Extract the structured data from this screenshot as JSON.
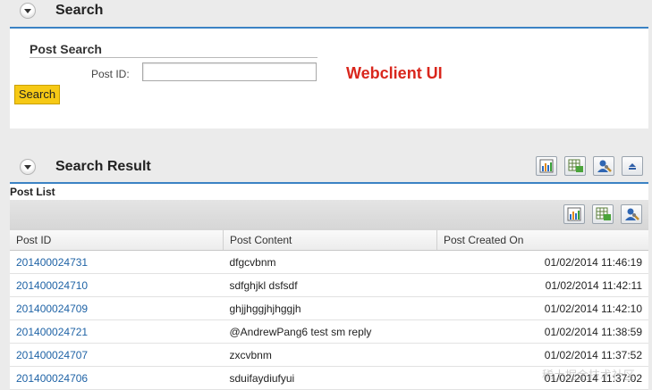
{
  "search_section": {
    "title": "Search",
    "group_title": "Post Search",
    "post_id_label": "Post ID:",
    "post_id_value": "",
    "search_button": "Search",
    "brand_label": "Webclient UI"
  },
  "result_section": {
    "title": "Search Result",
    "list_title": "Post List",
    "columns": [
      "Post ID",
      "Post Content",
      "Post Created On"
    ],
    "rows": [
      {
        "id": "201400024731",
        "content": "dfgcvbnm",
        "created": "01/02/2014 11:46:19"
      },
      {
        "id": "201400024710",
        "content": "sdfghjkl dsfsdf",
        "created": "01/02/2014 11:42:11"
      },
      {
        "id": "201400024709",
        "content": "ghjjhggjhjhggjh",
        "created": "01/02/2014 11:42:10"
      },
      {
        "id": "201400024721",
        "content": "@AndrewPang6 test sm reply",
        "created": "01/02/2014 11:38:59"
      },
      {
        "id": "201400024707",
        "content": "zxcvbnm",
        "created": "01/02/2014 11:37:52"
      },
      {
        "id": "201400024706",
        "content": "sduifaydiufyui",
        "created": "01/02/2014 11:37:02"
      }
    ]
  },
  "watermark": "稀土掘金技术社区",
  "colors": {
    "accent_line": "#3b82c4",
    "link": "#1f63a6",
    "brand_red": "#d9261c",
    "button_yellow": "#f6c915"
  },
  "icons": [
    "collapse-toggle-icon",
    "chart-icon",
    "table-export-icon",
    "personalize-icon",
    "collapse-up-icon"
  ]
}
